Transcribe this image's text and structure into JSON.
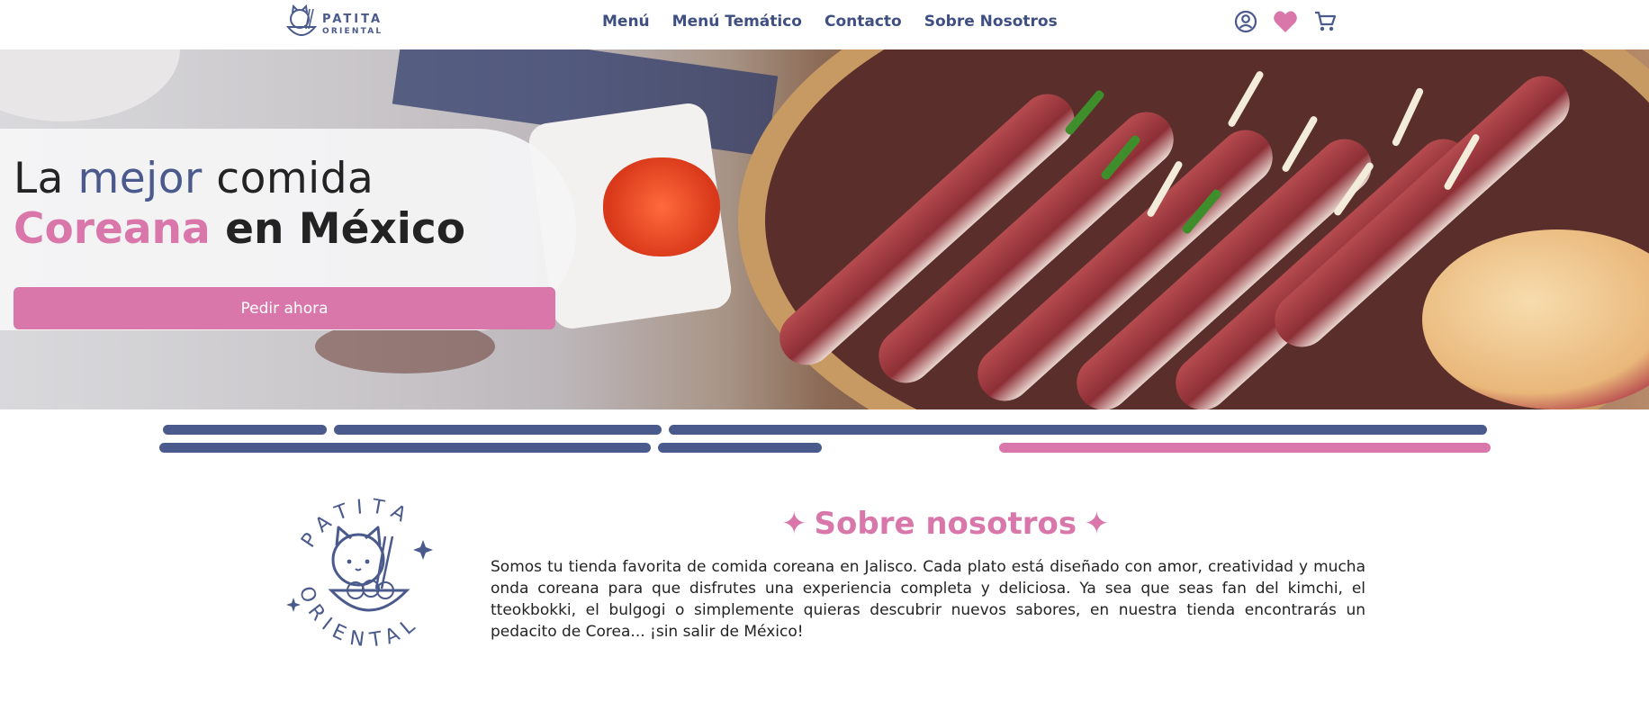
{
  "header": {
    "logo_text_top": "PATITA",
    "logo_text_bottom": "ORIENTAL",
    "nav": [
      "Menú",
      "Menú Temático",
      "Contacto",
      "Sobre Nosotros"
    ],
    "icons": [
      "user-circle-icon",
      "heart-icon",
      "cart-icon"
    ]
  },
  "hero": {
    "line1_a": "La",
    "line1_b": "mejor",
    "line1_c": "comida",
    "line2_a": "Coreana",
    "line2_b": "en México",
    "cta": "Pedir ahora"
  },
  "about": {
    "title": "Sobre nosotros",
    "logo_text_top": "PATITA",
    "logo_text_bottom": "ORIENTAL",
    "body": "Somos tu tienda favorita de comida coreana en Jalisco. Cada plato está diseñado con amor, creatividad y mucha onda coreana para que disfrutes una experiencia completa y deliciosa. Ya sea que seas fan del kimchi, el tteokbokki, el bulgogi o simplemente quieras descubrir nuevos sabores, en nuestra tienda encontrarás un pedacito de Corea... ¡sin salir de México!"
  },
  "colors": {
    "primary": "#4a5a8c",
    "accent_pink": "#d977ab",
    "text_dark": "#232323"
  }
}
